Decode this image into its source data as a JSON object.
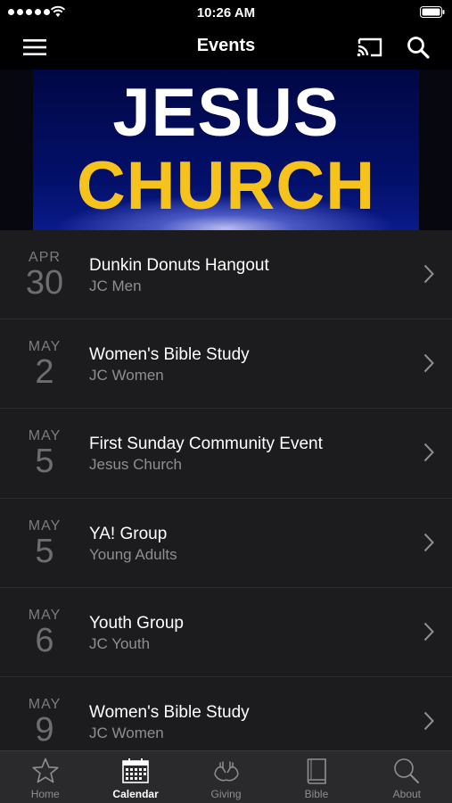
{
  "status_bar": {
    "time": "10:26 AM"
  },
  "nav": {
    "title": "Events"
  },
  "banner": {
    "line1": "JESUS",
    "line2": "CHURCH"
  },
  "events": [
    {
      "month": "APR",
      "day": "30",
      "title": "Dunkin Donuts Hangout",
      "subtitle": "JC Men"
    },
    {
      "month": "MAY",
      "day": "2",
      "title": "Women's Bible Study",
      "subtitle": "JC Women"
    },
    {
      "month": "MAY",
      "day": "5",
      "title": "First Sunday Community Event",
      "subtitle": "Jesus Church"
    },
    {
      "month": "MAY",
      "day": "5",
      "title": "YA! Group",
      "subtitle": "Young Adults"
    },
    {
      "month": "MAY",
      "day": "6",
      "title": "Youth Group",
      "subtitle": "JC Youth"
    },
    {
      "month": "MAY",
      "day": "9",
      "title": "Women's Bible Study",
      "subtitle": "JC Women"
    }
  ],
  "tabs": [
    {
      "label": "Home",
      "icon": "star-icon"
    },
    {
      "label": "Calendar",
      "icon": "calendar-icon",
      "active": true
    },
    {
      "label": "Giving",
      "icon": "hands-icon"
    },
    {
      "label": "Bible",
      "icon": "book-icon"
    },
    {
      "label": "About",
      "icon": "search-icon"
    }
  ],
  "colors": {
    "accent_gold": "#f6c31d",
    "banner_blue": "#03106a",
    "list_bg": "#1c1c1e",
    "tab_bg": "#2a2a2c"
  }
}
